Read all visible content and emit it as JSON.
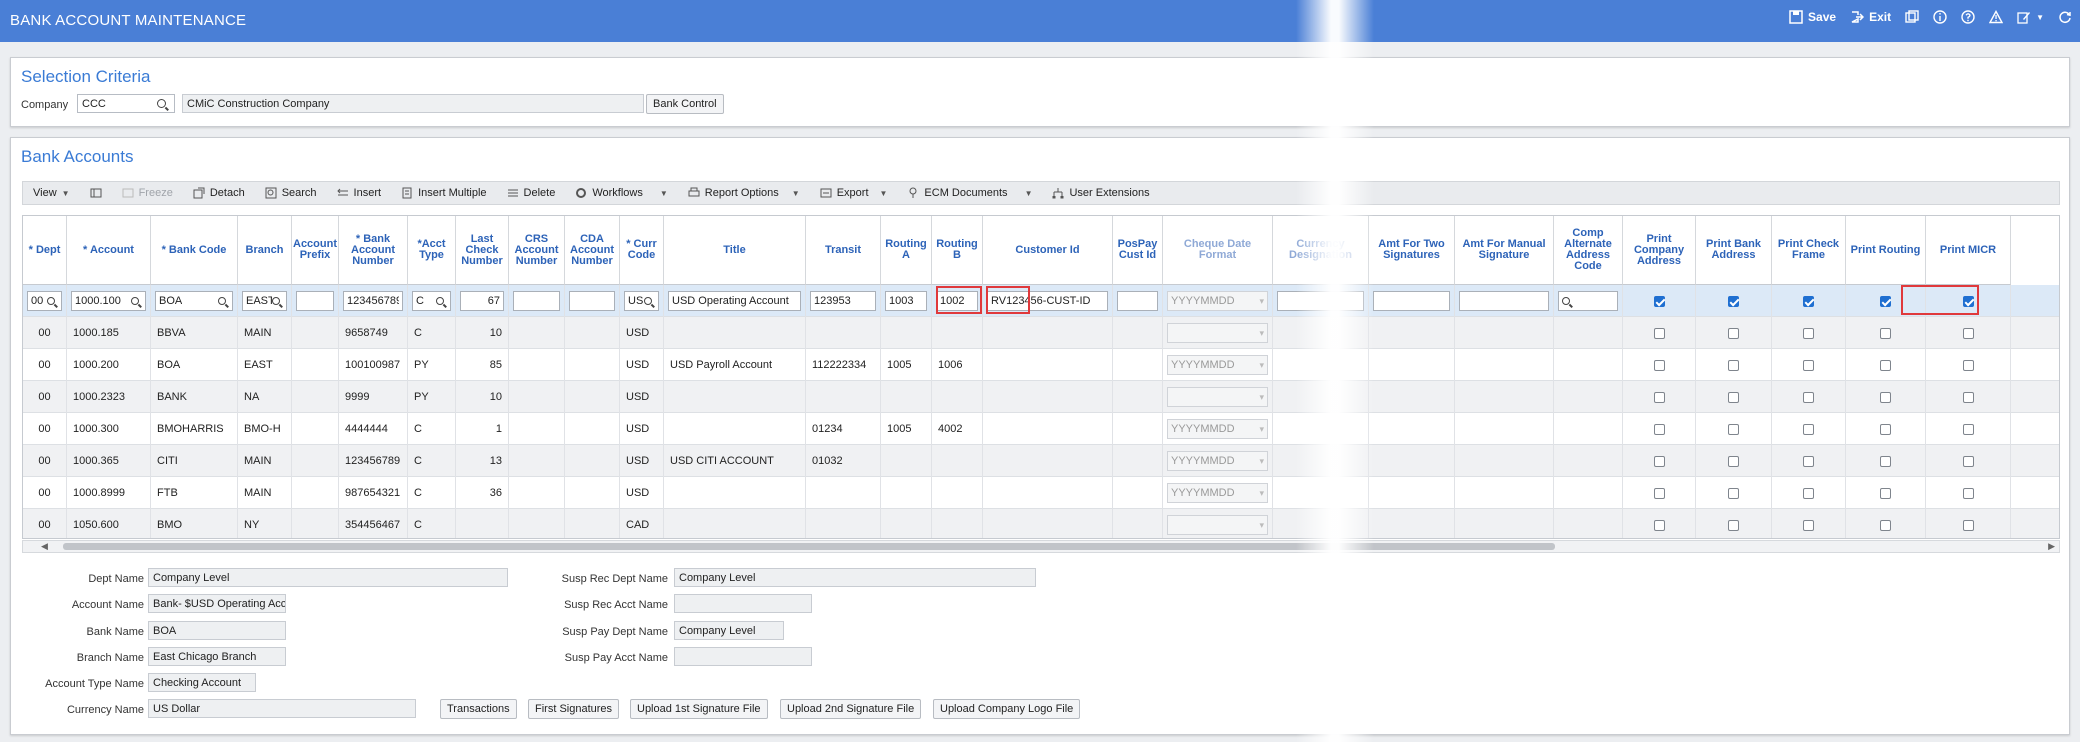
{
  "app": {
    "title": "BANK ACCOUNT MAINTENANCE"
  },
  "topbar": {
    "save_label": "Save",
    "exit_label": "Exit",
    "icons": [
      "save-icon",
      "exit-icon",
      "windows-icon",
      "info-icon",
      "help-icon",
      "warning-icon",
      "edit-icon",
      "refresh-icon"
    ]
  },
  "selection": {
    "title": "Selection Criteria",
    "company_label": "Company",
    "company_value": "CCC",
    "company_name": "CMiC Construction Company",
    "bank_control_label": "Bank Control"
  },
  "bank_accounts": {
    "title": "Bank Accounts",
    "toolbar": {
      "view": "View",
      "freeze": "Freeze",
      "detach": "Detach",
      "search": "Search",
      "insert": "Insert",
      "insert_multiple": "Insert Multiple",
      "delete": "Delete",
      "workflows": "Workflows",
      "report_options": "Report Options",
      "export": "Export",
      "ecm_documents": "ECM Documents",
      "user_extensions": "User Extensions"
    },
    "headers": {
      "dept": "* Dept",
      "account": "* Account",
      "bank_code": "* Bank Code",
      "branch": "Branch",
      "account_prefix": "Account Prefix",
      "bank_account_number": "* Bank Account Number",
      "acct_type": "*Acct Type",
      "last_check_number": "Last Check Number",
      "crs_account_number": "CRS Account Number",
      "cda_account_number": "CDA Account Number",
      "curr_code": "* Curr Code",
      "title": "Title",
      "transit": "Transit",
      "routing_a": "Routing A",
      "routing_b": "Routing B",
      "customer_id": "Customer Id",
      "pospay_cust_id": "PosPay Cust Id",
      "cheque_date_format": "Cheque Date Format",
      "currency_designation": "Currency Designation",
      "amt_two_signatures": "Amt For Two Signatures",
      "amt_manual_signature": "Amt For Manual Signature",
      "comp_alt_address_code": "Comp Alternate Address Code",
      "print_company_address": "Print Company Address",
      "print_bank_address": "Print Bank Address",
      "print_check_frame": "Print Check Frame",
      "print_routing": "Print Routing",
      "print_micr": "Print MICR"
    },
    "edit_row": {
      "dept": "00",
      "account": "1000.100",
      "bank_code": "BOA",
      "branch": "EAST",
      "account_prefix": "",
      "bank_account_number": "123456789",
      "acct_type": "C",
      "last_check_number": "67",
      "curr_code": "USD",
      "title": "USD Operating Account",
      "transit": "123953",
      "routing_a": "1003",
      "routing_b": "1002",
      "customer_id": "RV123456-CUST-ID",
      "cheque_date_format": "YYYYMMDD",
      "print_company_address": true,
      "print_bank_address": true,
      "print_check_frame": true,
      "print_routing": true,
      "print_micr": true
    },
    "rows": [
      {
        "dept": "00",
        "account": "1000.185",
        "bank_code": "BBVA",
        "branch": "MAIN",
        "bank_account_number": "9658749",
        "acct_type": "C",
        "last_check_number": "10",
        "curr_code": "USD",
        "title": "",
        "transit": "",
        "routing_a": "",
        "routing_b": "",
        "cheque_date_format": "",
        "print_micr": false
      },
      {
        "dept": "00",
        "account": "1000.200",
        "bank_code": "BOA",
        "branch": "EAST",
        "bank_account_number": "100100987",
        "acct_type": "PY",
        "last_check_number": "85",
        "curr_code": "USD",
        "title": "USD Payroll Account",
        "transit": "112222334",
        "routing_a": "1005",
        "routing_b": "1006",
        "cheque_date_format": "YYYYMMDD",
        "print_micr": false
      },
      {
        "dept": "00",
        "account": "1000.2323",
        "bank_code": "BANK",
        "branch": "NA",
        "bank_account_number": "9999",
        "acct_type": "PY",
        "last_check_number": "10",
        "curr_code": "USD",
        "title": "",
        "transit": "",
        "routing_a": "",
        "routing_b": "",
        "cheque_date_format": "",
        "print_micr": false
      },
      {
        "dept": "00",
        "account": "1000.300",
        "bank_code": "BMOHARRIS",
        "branch": "BMO-H",
        "bank_account_number": "4444444",
        "acct_type": "C",
        "last_check_number": "1",
        "curr_code": "USD",
        "title": "",
        "transit": "01234",
        "routing_a": "1005",
        "routing_b": "4002",
        "cheque_date_format": "YYYYMMDD",
        "print_micr": false
      },
      {
        "dept": "00",
        "account": "1000.365",
        "bank_code": "CITI",
        "branch": "MAIN",
        "bank_account_number": "123456789",
        "acct_type": "C",
        "last_check_number": "13",
        "curr_code": "USD",
        "title": "USD CITI ACCOUNT",
        "transit": "01032",
        "routing_a": "",
        "routing_b": "",
        "cheque_date_format": "YYYYMMDD",
        "print_micr": false
      },
      {
        "dept": "00",
        "account": "1000.8999",
        "bank_code": "FTB",
        "branch": "MAIN",
        "bank_account_number": "987654321",
        "acct_type": "C",
        "last_check_number": "36",
        "curr_code": "USD",
        "title": "",
        "transit": "",
        "routing_a": "",
        "routing_b": "",
        "cheque_date_format": "YYYYMMDD",
        "print_micr": false
      },
      {
        "dept": "00",
        "account": "1050.600",
        "bank_code": "BMO",
        "branch": "NY",
        "bank_account_number": "354456467",
        "acct_type": "C",
        "last_check_number": "",
        "curr_code": "CAD",
        "title": "",
        "transit": "",
        "routing_a": "",
        "routing_b": "",
        "cheque_date_format": "",
        "print_micr": false
      }
    ]
  },
  "details": {
    "dept_name_label": "Dept Name",
    "dept_name": "Company Level",
    "account_name_label": "Account Name",
    "account_name": "Bank- $USD Operating Acc",
    "bank_name_label": "Bank Name",
    "bank_name": "BOA",
    "branch_name_label": "Branch Name",
    "branch_name": "East Chicago Branch",
    "account_type_name_label": "Account Type Name",
    "account_type_name": "Checking Account",
    "currency_name_label": "Currency Name",
    "currency_name": "US Dollar",
    "susp_rec_dept_name_label": "Susp Rec Dept Name",
    "susp_rec_dept_name": "Company Level",
    "susp_rec_acct_name_label": "Susp Rec Acct Name",
    "susp_rec_acct_name": "",
    "susp_pay_dept_name_label": "Susp Pay Dept Name",
    "susp_pay_dept_name": "Company Level",
    "susp_pay_acct_name_label": "Susp Pay Acct Name",
    "susp_pay_acct_name": ""
  },
  "bottom_buttons": {
    "transactions": "Transactions",
    "first_signatures": "First Signatures",
    "upload_1st": "Upload 1st Signature File",
    "upload_2nd": "Upload 2nd Signature File",
    "upload_logo": "Upload Company Logo File"
  },
  "colors": {
    "titlebar": "#4a7fd6",
    "header_text": "#2d63b8",
    "highlight": "#e0393b",
    "selected_row": "#dce9f7",
    "checkbox_on": "#1f6fd1"
  }
}
